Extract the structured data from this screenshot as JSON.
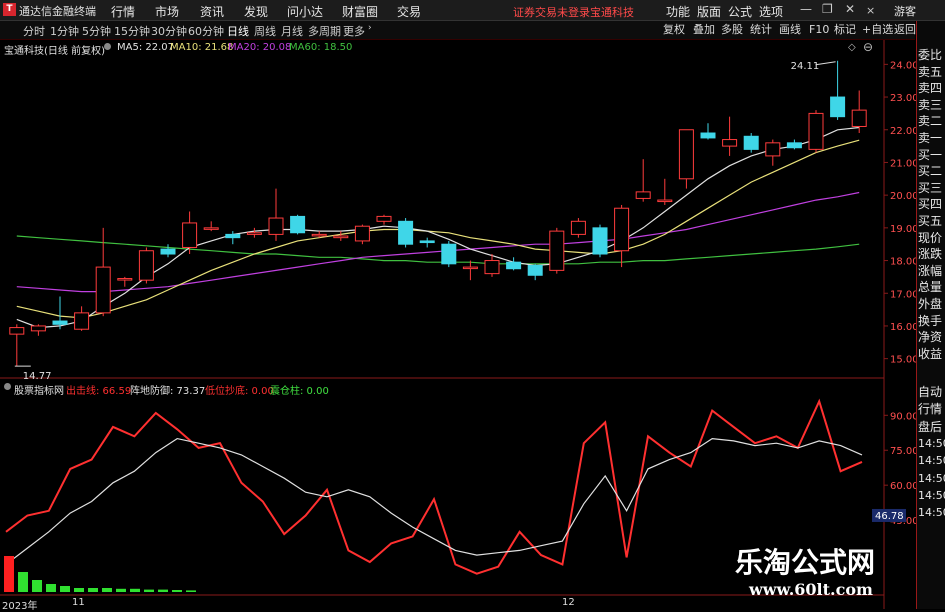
{
  "app": {
    "title": "通达信金融终端",
    "logo": "T"
  },
  "menu": [
    "行情",
    "市场",
    "资讯",
    "发现",
    "问小达",
    "财富圈",
    "交易"
  ],
  "notice": "证券交易未登录",
  "stock_name_top": "宝通科技",
  "window_menu": [
    "功能",
    "版面",
    "公式",
    "选项"
  ],
  "guest": "游客",
  "periods": [
    "分时",
    "1分钟",
    "5分钟",
    "15分钟",
    "30分钟",
    "60分钟",
    "日线",
    "周线",
    "月线",
    "多周期",
    "更多"
  ],
  "active_period": "日线",
  "toolbar_right": [
    "复权",
    "叠加",
    "多股",
    "统计",
    "画线",
    "F10",
    "标记",
    "+自选",
    "返回"
  ],
  "chart_header": {
    "name": "宝通科技(日线 前复权)"
  },
  "ma_legend": [
    {
      "label": "MA5: 22.07",
      "color": "#e0e0e0"
    },
    {
      "label": "MA10: 21.68",
      "color": "#e8e07a"
    },
    {
      "label": "MA20: 20.08",
      "color": "#c040e0"
    },
    {
      "label": "MA60: 18.50",
      "color": "#40c040"
    }
  ],
  "indicator_legend": {
    "name": "股票指标网",
    "items": [
      {
        "label": "出击线: 66.59",
        "color": "#ff3030"
      },
      {
        "label": "阵地防御: 73.37",
        "color": "#e0e0e0"
      },
      {
        "label": "低位抄底: 0.00",
        "color": "#ff3030"
      },
      {
        "label": "震仓柱: 0.00",
        "color": "#40e040"
      }
    ]
  },
  "right_panel": [
    "委比",
    "卖五",
    "卖四",
    "卖三",
    "卖二",
    "卖一",
    "买一",
    "买二",
    "买三",
    "买四",
    "买五",
    "现价",
    "涨跌",
    "涨幅",
    "总量",
    "外盘",
    "换手",
    "净资",
    "收益",
    "自动",
    "行情",
    "盘后",
    "14:50",
    "14:50",
    "14:50",
    "14:50",
    "14:50"
  ],
  "date_labels": [
    "2023年",
    "11",
    "12"
  ],
  "watermark": {
    "main": "乐淘公式网",
    "url": "www.60lt.com"
  },
  "colors": {
    "up": "#ff3c3c",
    "down": "#3fd6e8",
    "ma5": "#e0e0e0",
    "ma10": "#e8e07a",
    "ma20": "#c040e0",
    "ma60": "#40c040"
  },
  "chart_data": [
    {
      "type": "candlestick",
      "price_axis": {
        "ticks": [
          24.0,
          23.0,
          22.0,
          21.0,
          20.0,
          19.0,
          18.0,
          17.0,
          16.0,
          15.0
        ],
        "range": [
          14.5,
          24.5
        ]
      },
      "annotations": {
        "high": "24.11",
        "low": "14.77"
      },
      "candles": [
        {
          "o": 15.75,
          "h": 16.05,
          "l": 14.77,
          "c": 15.95
        },
        {
          "o": 15.85,
          "h": 16.05,
          "l": 15.7,
          "c": 16.0
        },
        {
          "o": 16.15,
          "h": 16.9,
          "l": 15.9,
          "c": 16.05
        },
        {
          "o": 15.9,
          "h": 16.6,
          "l": 15.85,
          "c": 16.4
        },
        {
          "o": 16.4,
          "h": 19.0,
          "l": 16.3,
          "c": 17.8
        },
        {
          "o": 17.45,
          "h": 17.5,
          "l": 17.2,
          "c": 17.45
        },
        {
          "o": 17.4,
          "h": 18.4,
          "l": 17.3,
          "c": 18.3
        },
        {
          "o": 18.35,
          "h": 18.5,
          "l": 18.1,
          "c": 18.2
        },
        {
          "o": 18.4,
          "h": 19.5,
          "l": 18.2,
          "c": 19.15
        },
        {
          "o": 19.0,
          "h": 19.2,
          "l": 18.9,
          "c": 19.0
        },
        {
          "o": 18.8,
          "h": 18.9,
          "l": 18.5,
          "c": 18.7
        },
        {
          "o": 18.8,
          "h": 19.0,
          "l": 18.7,
          "c": 18.85
        },
        {
          "o": 18.8,
          "h": 20.2,
          "l": 18.6,
          "c": 19.3
        },
        {
          "o": 19.35,
          "h": 19.4,
          "l": 18.8,
          "c": 18.85
        },
        {
          "o": 18.8,
          "h": 18.9,
          "l": 18.7,
          "c": 18.8
        },
        {
          "o": 18.7,
          "h": 18.9,
          "l": 18.6,
          "c": 18.75
        },
        {
          "o": 18.6,
          "h": 19.1,
          "l": 18.5,
          "c": 19.05
        },
        {
          "o": 19.2,
          "h": 19.4,
          "l": 19.1,
          "c": 19.35
        },
        {
          "o": 19.2,
          "h": 19.3,
          "l": 18.4,
          "c": 18.5
        },
        {
          "o": 18.6,
          "h": 18.7,
          "l": 18.4,
          "c": 18.55
        },
        {
          "o": 18.5,
          "h": 18.6,
          "l": 17.8,
          "c": 17.9
        },
        {
          "o": 17.8,
          "h": 18.0,
          "l": 17.4,
          "c": 17.8
        },
        {
          "o": 17.6,
          "h": 18.2,
          "l": 17.5,
          "c": 18.0
        },
        {
          "o": 17.95,
          "h": 18.1,
          "l": 17.7,
          "c": 17.75
        },
        {
          "o": 17.85,
          "h": 17.9,
          "l": 17.4,
          "c": 17.55
        },
        {
          "o": 17.7,
          "h": 19.0,
          "l": 17.6,
          "c": 18.9
        },
        {
          "o": 18.8,
          "h": 19.3,
          "l": 18.7,
          "c": 19.2
        },
        {
          "o": 19.0,
          "h": 19.1,
          "l": 18.1,
          "c": 18.2
        },
        {
          "o": 18.3,
          "h": 19.7,
          "l": 17.8,
          "c": 19.6
        },
        {
          "o": 19.9,
          "h": 21.1,
          "l": 19.8,
          "c": 20.1
        },
        {
          "o": 19.85,
          "h": 20.5,
          "l": 19.7,
          "c": 19.85
        },
        {
          "o": 20.5,
          "h": 22.0,
          "l": 20.2,
          "c": 22.0
        },
        {
          "o": 21.9,
          "h": 22.2,
          "l": 21.7,
          "c": 21.75
        },
        {
          "o": 21.5,
          "h": 22.4,
          "l": 21.2,
          "c": 21.7
        },
        {
          "o": 21.8,
          "h": 21.9,
          "l": 21.3,
          "c": 21.4
        },
        {
          "o": 21.2,
          "h": 21.7,
          "l": 20.9,
          "c": 21.6
        },
        {
          "o": 21.6,
          "h": 21.7,
          "l": 21.4,
          "c": 21.45
        },
        {
          "o": 21.4,
          "h": 22.6,
          "l": 21.3,
          "c": 22.5
        },
        {
          "o": 23.0,
          "h": 24.11,
          "l": 22.3,
          "c": 22.4
        },
        {
          "o": 22.1,
          "h": 23.2,
          "l": 21.9,
          "c": 22.6
        }
      ],
      "ma": {
        "ma5": [
          16.2,
          15.95,
          16.0,
          16.15,
          16.6,
          17.0,
          17.5,
          17.9,
          18.4,
          18.6,
          18.8,
          18.9,
          18.95,
          18.95,
          18.9,
          18.9,
          18.95,
          19.05,
          19.0,
          18.9,
          18.65,
          18.35,
          18.15,
          17.95,
          17.85,
          17.9,
          18.1,
          18.3,
          18.6,
          19.0,
          19.5,
          20.0,
          20.5,
          20.9,
          21.2,
          21.4,
          21.5,
          21.7,
          22.0,
          22.07
        ],
        "ma10": [
          16.6,
          16.45,
          16.3,
          16.25,
          16.4,
          16.6,
          16.8,
          17.1,
          17.4,
          17.7,
          17.95,
          18.2,
          18.4,
          18.6,
          18.7,
          18.8,
          18.9,
          18.95,
          18.95,
          18.9,
          18.85,
          18.7,
          18.6,
          18.5,
          18.35,
          18.3,
          18.25,
          18.2,
          18.3,
          18.5,
          18.8,
          19.2,
          19.6,
          20.0,
          20.4,
          20.7,
          21.0,
          21.3,
          21.5,
          21.68
        ],
        "ma20": [
          17.2,
          17.15,
          17.1,
          17.05,
          17.05,
          17.1,
          17.15,
          17.2,
          17.3,
          17.4,
          17.5,
          17.6,
          17.7,
          17.8,
          17.9,
          18.0,
          18.1,
          18.15,
          18.2,
          18.25,
          18.3,
          18.35,
          18.4,
          18.45,
          18.5,
          18.5,
          18.55,
          18.6,
          18.65,
          18.75,
          18.85,
          18.95,
          19.1,
          19.25,
          19.4,
          19.55,
          19.7,
          19.85,
          19.95,
          20.08
        ],
        "ma60": [
          18.75,
          18.7,
          18.65,
          18.6,
          18.55,
          18.5,
          18.45,
          18.4,
          18.35,
          18.3,
          18.25,
          18.2,
          18.2,
          18.15,
          18.1,
          18.1,
          18.05,
          18.0,
          18.0,
          17.95,
          17.95,
          17.95,
          17.9,
          17.9,
          17.9,
          17.9,
          17.9,
          17.95,
          17.95,
          18.0,
          18.0,
          18.05,
          18.1,
          18.15,
          18.2,
          18.25,
          18.3,
          18.35,
          18.42,
          18.5
        ]
      }
    },
    {
      "type": "line",
      "y_axis": {
        "ticks": [
          90.0,
          75.0,
          60.0,
          45.0
        ],
        "range": [
          15,
          100
        ]
      },
      "current_value_label": "46.78",
      "series": [
        {
          "name": "出击线",
          "color": "#ff3030",
          "values": [
            40,
            47,
            49,
            67,
            71,
            85,
            81,
            91,
            84,
            76,
            78,
            61,
            53,
            39,
            47,
            58,
            32,
            27,
            35,
            38,
            54,
            26,
            22,
            25,
            40,
            30,
            26,
            78,
            87,
            29,
            81,
            74,
            68,
            92,
            85,
            78,
            81,
            76,
            96,
            66,
            70
          ]
        },
        {
          "name": "阵地防御",
          "color": "#e0e0e0",
          "values": [
            26,
            33,
            40,
            48,
            53,
            61,
            66,
            74,
            80,
            78,
            76,
            73,
            68,
            63,
            57,
            55,
            58,
            55,
            48,
            42,
            37,
            32,
            30,
            31,
            32,
            34,
            36,
            52,
            64,
            49,
            67,
            71,
            74,
            80,
            79,
            77,
            78,
            76,
            79,
            77,
            73
          ]
        },
        {
          "name": "震仓柱",
          "color": "#40e040",
          "values": [
            0,
            0,
            0,
            0,
            0,
            0,
            0,
            0,
            0,
            0,
            0,
            0,
            0,
            0,
            0,
            0,
            0,
            0,
            0,
            0,
            0,
            0,
            0,
            0,
            0,
            0,
            0,
            0,
            0,
            0,
            0,
            0,
            0,
            0,
            0,
            0,
            0,
            0,
            0,
            0,
            0
          ]
        }
      ],
      "volume_bars": [
        9,
        5,
        3,
        2,
        1.5,
        1,
        1,
        1,
        0.8,
        0.8,
        0.6,
        0.6,
        0.5,
        0.4
      ]
    }
  ]
}
